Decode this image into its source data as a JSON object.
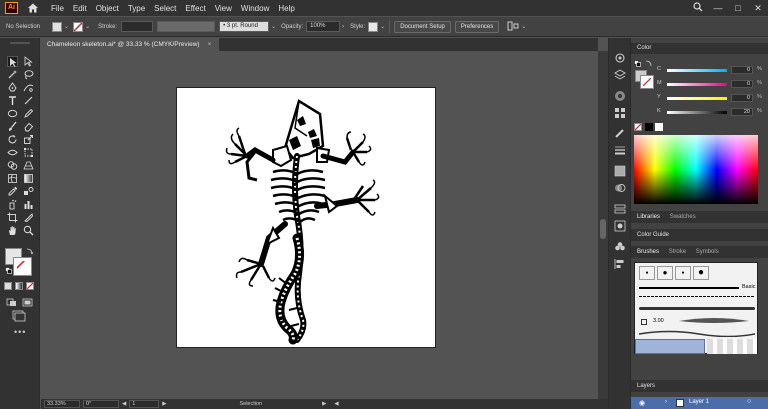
{
  "app": {
    "logo": "Ai"
  },
  "menu": [
    "File",
    "Edit",
    "Object",
    "Type",
    "Select",
    "Effect",
    "View",
    "Window",
    "Help"
  ],
  "control_bar": {
    "selection": "No Selection",
    "stroke_label": "Stroke:",
    "brush": "3 pt. Round",
    "opacity_label": "Opacity:",
    "opacity_value": "100%",
    "style_label": "Style:",
    "document_setup": "Document Setup",
    "preferences": "Preferences"
  },
  "document": {
    "tab_title": "Chameleon skeleton.ai* @ 33.33 % (CMYK/Preview)",
    "close": "×"
  },
  "status": {
    "zoom": "33.33%",
    "rotation": "0°",
    "artboard": "1",
    "tool": "Selection"
  },
  "panels": {
    "color": {
      "title": "Color",
      "channels": [
        {
          "label": "C",
          "value": "0",
          "unit": "%"
        },
        {
          "label": "M",
          "value": "0",
          "unit": "%"
        },
        {
          "label": "Y",
          "value": "0",
          "unit": "%"
        },
        {
          "label": "K",
          "value": "20",
          "unit": "%"
        }
      ]
    },
    "libraries_tab": "Libraries",
    "swatches_tab": "Swatches",
    "color_guide": "Color Guide",
    "brushes_tab": "Brushes",
    "stroke_tab": "Stroke",
    "symbols_tab": "Symbols",
    "brush_basic": "Basic",
    "brush_size": "3.00",
    "layers": "Layers",
    "layer_name": "Layer 1"
  },
  "colors": {
    "accent": "#ff9a00",
    "cyan": "#00aeef",
    "magenta": "#ec008c",
    "yellow": "#fff200",
    "selected_layer": "#4b6ea9"
  }
}
